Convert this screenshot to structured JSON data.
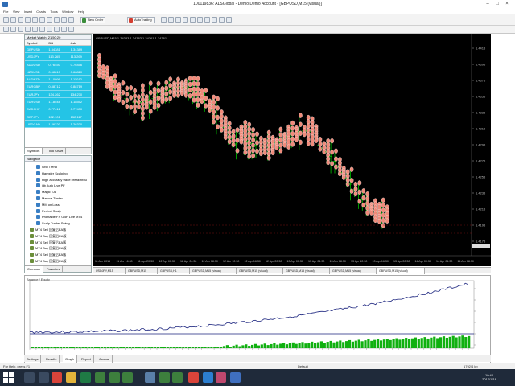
{
  "window": {
    "title": "100119836: ALSGlobal - Demo Demo Account - [GBPUSD,M15 (visual)]"
  },
  "menu": {
    "items": [
      "File",
      "View",
      "Insert",
      "Charts",
      "Tools",
      "Window",
      "Help"
    ]
  },
  "toolbar": {
    "new_order_label": "New Order",
    "autotrading_label": "AutoTrading"
  },
  "market_watch": {
    "title": "Market Watch: 21:50:20",
    "columns": [
      "Symbol",
      "Bid",
      "Ask"
    ],
    "rows": [
      {
        "symbol": "GBPUSD",
        "bid": "1.34381",
        "ask": "1.34389"
      },
      {
        "symbol": "USDJPY",
        "bid": "113.265",
        "ask": "113.269"
      },
      {
        "symbol": "AUDUSD",
        "bid": "0.76450",
        "ask": "0.76456"
      },
      {
        "symbol": "NZDUSD",
        "bid": "0.68810",
        "ask": "0.68820"
      },
      {
        "symbol": "AUDNZD",
        "bid": "1.10999",
        "ask": "1.11012"
      },
      {
        "symbol": "EURGBP",
        "bid": "0.88712",
        "ask": "0.88719"
      },
      {
        "symbol": "EURJPY",
        "bid": "134.262",
        "ask": "134.270"
      },
      {
        "symbol": "EURUSD",
        "bid": "1.18548",
        "ask": "1.18552"
      },
      {
        "symbol": "CADCHF",
        "bid": "0.77412",
        "ask": "0.77430"
      },
      {
        "symbol": "GBPJPY",
        "bid": "152.101",
        "ask": "152.117"
      },
      {
        "symbol": "USDCAD",
        "bid": "1.26320",
        "ask": "1.26330"
      }
    ],
    "tabs": [
      "Symbols",
      "Tick Chart"
    ]
  },
  "navigator": {
    "title": "Navigator",
    "items": [
      "Grid Trend",
      "Hamster Scalping",
      "High accuracy trade breakthrou",
      "ilib Auto Live PF",
      "Magic EA",
      "Manual Trader",
      "MM on Loss",
      "Perfect Scalp",
      "Profitable FX GBP Live MT4",
      "Scalp Trader Swing",
      "MT4 Sell 回复后EA版",
      "MT4 Buy 回复后EA版",
      "MT4 Sell 回复后EA版",
      "MT4 Buy 回复后EA版",
      "MT4 Sell 回复后EA版",
      "MT4 Buy 回复后EA版"
    ],
    "tabs": [
      "Common",
      "Favorites"
    ]
  },
  "chart": {
    "title": "GBPUSD,M15  1.34383 1.34383 1.34361 1.34361",
    "price_labels": [
      "1.4415",
      "1.4395",
      "1.4375",
      "1.4355",
      "1.4335",
      "1.4315",
      "1.4295",
      "1.4275",
      "1.4255",
      "1.4235",
      "1.4215",
      "1.4195",
      "1.4175"
    ],
    "time_labels": [
      "11 Apr 2016",
      "11 Apr 16:30",
      "11 Apr 20:30",
      "12 Apr 00:30",
      "12 Apr 04:30",
      "12 Apr 08:30",
      "12 Apr 12:30",
      "12 Apr 16:30",
      "12 Apr 20:30",
      "13 Apr 00:30",
      "13 Apr 04:30",
      "13 Apr 08:30",
      "13 Apr 12:30",
      "13 Apr 16:30",
      "13 Apr 20:30",
      "14 Apr 00:30",
      "14 Apr 04:30",
      "14 Apr 08:30"
    ],
    "colors": {
      "background": "#000000",
      "candle": "#00c000",
      "marker": "#f08a7a",
      "grid": "#2a2a2a"
    }
  },
  "chart_tabs": [
    "USDJPY,M15",
    "GBPUSD,M15",
    "GBPUSD,H1",
    "GBPUSD,M15 (visual)",
    "GBPUSD,M15 (visual)",
    "GBPUSD,M15 (visual)",
    "GBPUSD,M15 (visual)",
    "GBPUSD,M15 (visual)"
  ],
  "equity_panel": {
    "title": "Balance / Equity",
    "colors": {
      "balance": "#1a237e",
      "volume": "#10b010"
    }
  },
  "bottom_tabs": [
    "Settings",
    "Results",
    "Graph",
    "Report",
    "Journal"
  ],
  "status": {
    "left": "For Help, press F1",
    "middle": "Default",
    "right": "1792/4 kb"
  },
  "taskbar": {
    "time": "19:44",
    "date": "2017/1/18"
  }
}
